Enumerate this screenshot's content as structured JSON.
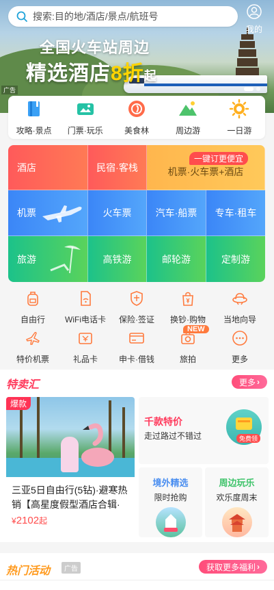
{
  "search": {
    "placeholder": "搜索:目的地/酒店/景点/航班号"
  },
  "header": {
    "mine_label": "我的"
  },
  "banner": {
    "title_line1": "全国火车站周边",
    "title_line2_a": "精选酒店",
    "title_line2_hl": "8折",
    "title_line2_b": "起",
    "ad_tag": "广告"
  },
  "quick_icons": [
    {
      "label": "攻略·景点",
      "icon": "guide-book-icon",
      "color": "#3aa0f5"
    },
    {
      "label": "门票·玩乐",
      "icon": "ticket-icon",
      "color": "#25c2a5"
    },
    {
      "label": "美食林",
      "icon": "food-icon",
      "color": "#ff6b4a"
    },
    {
      "label": "周边游",
      "icon": "mountain-icon",
      "color": "#4dc36b"
    },
    {
      "label": "一日游",
      "icon": "sun-icon",
      "color": "#ffb020"
    }
  ],
  "grid": {
    "hotel": "酒店",
    "inn": "民宿·客栈",
    "combo": "机票·火车票+酒店",
    "oneclick_badge": "一键订更便宜",
    "flight": "机票",
    "train": "火车票",
    "car_ship": "汽车·船票",
    "car_rental": "专车·租车",
    "travel": "旅游",
    "highspeed": "高铁游",
    "cruise": "邮轮游",
    "custom": "定制游"
  },
  "services": [
    {
      "label": "自由行",
      "icon": "backpack-icon"
    },
    {
      "label": "WiFi电话卡",
      "icon": "wifi-card-icon"
    },
    {
      "label": "保险·签证",
      "icon": "shield-icon"
    },
    {
      "label": "换钞·购物",
      "icon": "shopping-bag-icon"
    },
    {
      "label": "当地向导",
      "icon": "guide-hat-icon"
    },
    {
      "label": "特价机票",
      "icon": "plane-icon"
    },
    {
      "label": "礼品卡",
      "icon": "gift-card-icon"
    },
    {
      "label": "申卡·借钱",
      "icon": "credit-card-icon"
    },
    {
      "label": "旅拍",
      "icon": "camera-icon"
    },
    {
      "label": "更多",
      "icon": "more-icon"
    }
  ],
  "new_badge": "NEW",
  "sale": {
    "title": "特卖汇",
    "more_label": "更多",
    "big_card": {
      "tag": "爆款",
      "text": "三亚5日自由行(5钻)·避寒热销【高星度假型酒店合辑·",
      "price_symbol": "¥",
      "price": "2102",
      "price_suffix": "起"
    },
    "right_top": {
      "title": "千款特价",
      "subtitle": "走过路过不错过",
      "free_tag": "免费领"
    },
    "small_left": {
      "title": "境外精选",
      "subtitle": "限时抢购",
      "color": "#4a8ef0"
    },
    "small_right": {
      "title": "周边玩乐",
      "subtitle": "欢乐度周末",
      "color": "#3ec36a"
    }
  },
  "hot": {
    "title": "热门活动",
    "ad_badge": "广告",
    "benefit_label": "获取更多福利"
  }
}
